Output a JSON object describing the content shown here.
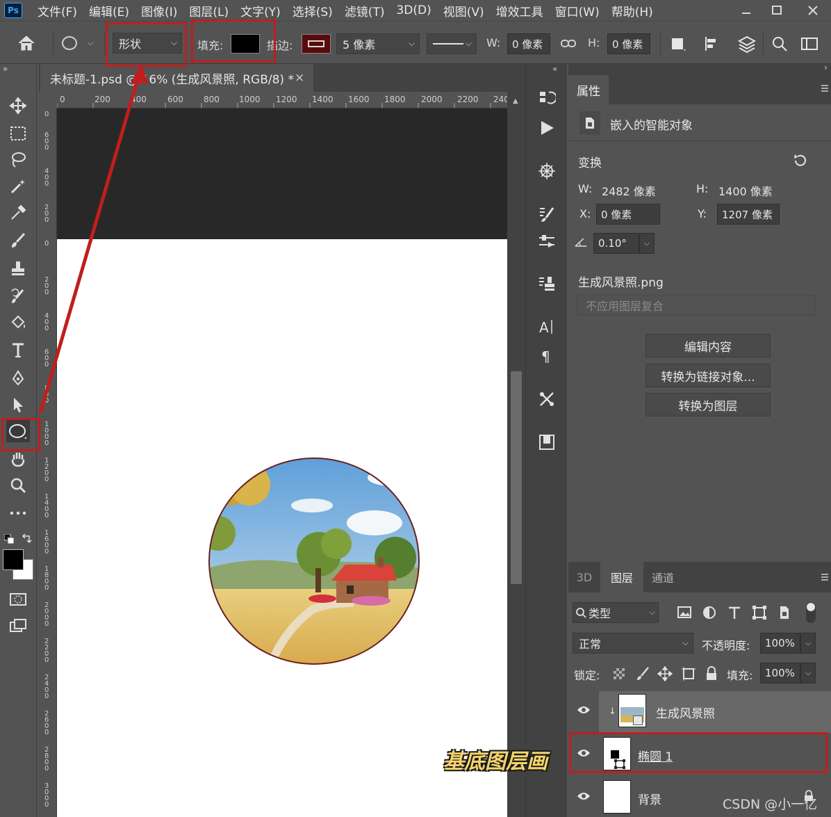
{
  "app": {
    "logo": "Ps"
  },
  "menu": [
    "文件(F)",
    "编辑(E)",
    "图像(I)",
    "图层(L)",
    "文字(Y)",
    "选择(S)",
    "滤镜(T)",
    "3D(D)",
    "视图(V)",
    "增效工具",
    "窗口(W)",
    "帮助(H)"
  ],
  "options": {
    "mode": "形状",
    "fill_label": "填充:",
    "stroke_label": "描边:",
    "stroke_size": "5 像素",
    "w_label": "W:",
    "w_value": "0 像素",
    "h_label": "H:",
    "h_value": "0 像素",
    "fill_color": "#000000",
    "stroke_color": "#5a0a0a"
  },
  "document": {
    "tab_title": "未标题-1.psd @ 16% (生成风景照, RGB/8) *",
    "close": "×",
    "ruler_h": [
      "0",
      "200",
      "400",
      "600",
      "800",
      "1000",
      "1200",
      "1400",
      "1600",
      "1800",
      "2000",
      "2200",
      "240"
    ],
    "ruler_v": [
      "0",
      "6 0 0",
      "4 0 0",
      "2 0 0",
      "0",
      "2 0 0",
      "4 0 0",
      "6 0 0",
      "8 0 0",
      "1 0 0 0",
      "1 2 0 0",
      "1 4 0 0",
      "1 6 0 0",
      "1 8 0 0",
      "2 0 0 0",
      "2 2 0 0",
      "2 4 0 0",
      "2 6 0 0",
      "2 8 0 0",
      "3 0 0 0"
    ]
  },
  "properties": {
    "tab": "属性",
    "type": "嵌入的智能对象",
    "transform_label": "变换",
    "w_label": "W:",
    "w_value": "2482 像素",
    "h_label": "H:",
    "h_value": "1400 像素",
    "x_label": "X:",
    "x_value": "0 像素",
    "y_label": "Y:",
    "y_value": "1207 像素",
    "angle": "0.10°",
    "filename": "生成风景照.png",
    "comp_placeholder": "不应用图层复合",
    "buttons": [
      "编辑内容",
      "转换为链接对象...",
      "转换为图层"
    ]
  },
  "layers": {
    "tabs": [
      "3D",
      "图层",
      "通道"
    ],
    "filter": "类型",
    "blend": "正常",
    "opacity_label": "不透明度:",
    "opacity": "100%",
    "lock_label": "锁定:",
    "fill_label": "填充:",
    "fill": "100%",
    "items": [
      "生成风景照",
      "椭圆 1",
      "背景"
    ]
  },
  "annotation": {
    "caption": "基底图层画"
  },
  "watermark": "CSDN @小一亿"
}
